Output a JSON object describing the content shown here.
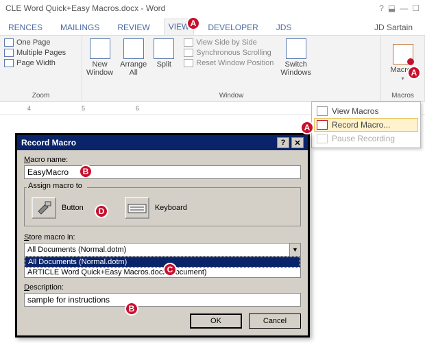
{
  "title_bar": {
    "document": "CLE Word Quick+Easy Macros.docx - Word",
    "help_glyph": "?",
    "win_ctrls": [
      "▢",
      "—",
      "▢"
    ]
  },
  "tabs": {
    "items": [
      "RENCES",
      "MAILINGS",
      "REVIEW",
      "VIEW",
      "DEVELOPER",
      "JDS"
    ],
    "active_index": 3,
    "user": "JD Sartain"
  },
  "ribbon": {
    "zoom": {
      "one_page": "One Page",
      "multiple_pages": "Multiple Pages",
      "page_width": "Page Width",
      "label": "Zoom"
    },
    "window": {
      "new_window": "New\nWindow",
      "arrange_all": "Arrange\nAll",
      "split": "Split",
      "view_side": "View Side by Side",
      "sync_scroll": "Synchronous Scrolling",
      "reset_pos": "Reset Window Position",
      "switch": "Switch\nWindows",
      "label": "Window"
    },
    "macros": {
      "btn": "Macros",
      "label": "Macros"
    }
  },
  "ruler": [
    "4",
    "5",
    "6"
  ],
  "macros_menu": {
    "view": "View Macros",
    "record": "Record Macro...",
    "pause": "Pause Recording"
  },
  "dialog": {
    "title": "Record Macro",
    "macro_name_label": "Macro name:",
    "macro_name_value": "EasyMacro",
    "assign_label": "Assign macro to",
    "button_label": "Button",
    "keyboard_label": "Keyboard",
    "store_label": "Store macro in:",
    "store_selected": "All Documents (Normal.dotm)",
    "store_options": [
      "All Documents (Normal.dotm)",
      "ARTICLE Word Quick+Easy Macros.docx (document)"
    ],
    "desc_label": "Description:",
    "desc_value": "sample for instructions",
    "ok": "OK",
    "cancel": "Cancel"
  },
  "badges": {
    "A": "A",
    "B": "B",
    "C": "C",
    "D": "D"
  }
}
